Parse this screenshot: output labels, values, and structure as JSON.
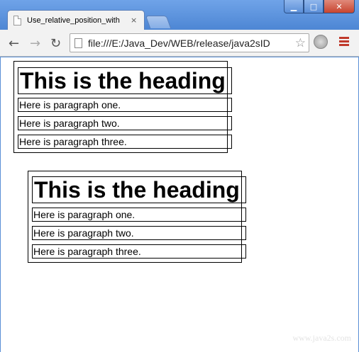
{
  "browser": {
    "tab_title": "Use_relative_position_with",
    "tab_close": "×",
    "url": "file:///E:/Java_Dev/WEB/release/java2sID",
    "window_buttons": {
      "minimize": "▁",
      "maximize": "□",
      "close": "✕"
    }
  },
  "toolbar": {
    "back": "←",
    "forward": "→",
    "reload": "↻",
    "star": "☆"
  },
  "page": {
    "section_one": {
      "heading": "This is the heading",
      "paragraphs": [
        "Here is paragraph one.",
        "Here is paragraph two.",
        "Here is paragraph three."
      ]
    },
    "section_two": {
      "heading": "This is the heading",
      "paragraphs": [
        "Here is paragraph one.",
        "Here is paragraph two.",
        "Here is paragraph three."
      ]
    },
    "watermark": "www.java2s.com"
  }
}
